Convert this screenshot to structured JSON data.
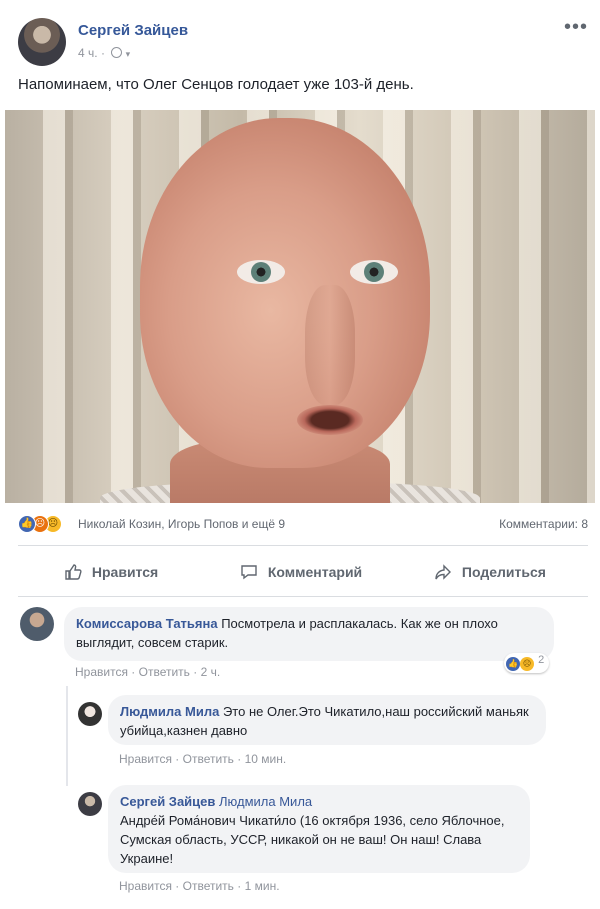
{
  "post": {
    "author": "Сергей Зайцев",
    "time": "4 ч.",
    "meta_separator": "·",
    "menu_glyph": "•••",
    "text": "Напоминаем, что Олег Сенцов голодает уже 103-й день.",
    "photo_icon": "portrait-photo"
  },
  "reactions": {
    "icons": [
      "like-icon",
      "angry-icon",
      "sad-icon"
    ],
    "reactors_text": "Николай Козин, Игорь Попов и ещё 9",
    "comments_label": "Комментарии: 8"
  },
  "actions": {
    "like": "Нравится",
    "comment": "Комментарий",
    "share": "Поделиться"
  },
  "comments": [
    {
      "author": "Комиссарова Татьяна",
      "text": "Посмотрела и расплакалась. Как же он плохо выглядит, совсем старик.",
      "like_label": "Нравится",
      "reply_label": "Ответить",
      "sep": "·",
      "time": "2 ч.",
      "reaction_count": "2"
    },
    {
      "author": "Людмила Мила",
      "text": "Это не Олег.Это Чикатило,наш российский маньяк убийца,казнен давно",
      "like_label": "Нравится",
      "reply_label": "Ответить",
      "sep": "·",
      "time": "10 мин."
    },
    {
      "author": "Сергей Зайцев",
      "mention": "Людмила Мила",
      "text": "Андре́й Рома́нович Чикати́ло (16 октября 1936, село Яблочное, Сумская область, УССР, никакой он не ваш! Он наш! Слава Украине!",
      "like_label": "Нравится",
      "reply_label": "Ответить",
      "sep": "·",
      "time": "1 мин."
    }
  ],
  "colors": {
    "link": "#365899",
    "muted": "#90949c",
    "bubble": "#f2f3f5",
    "like": "#4267b2"
  }
}
